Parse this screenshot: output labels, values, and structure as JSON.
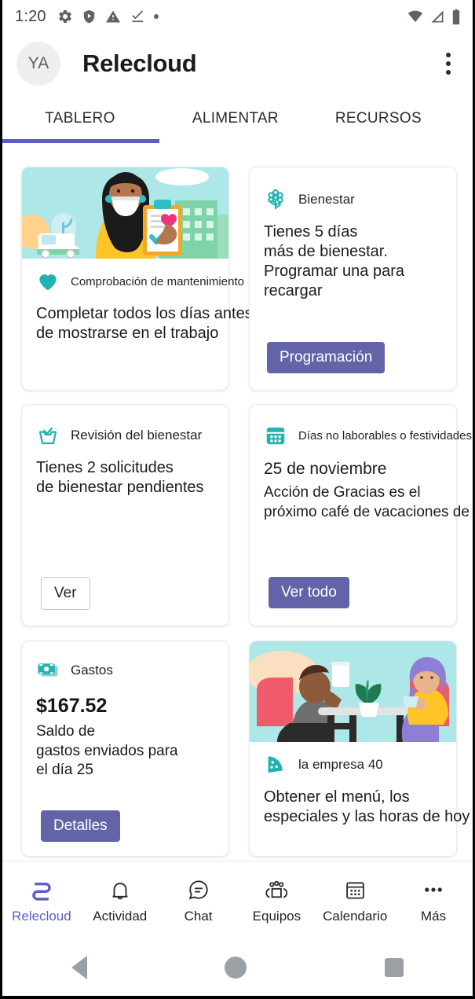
{
  "status_bar": {
    "time": "1:20",
    "left_icons": [
      "gear-icon",
      "shield-play-icon",
      "warning-icon",
      "check-underline-icon",
      "dot-icon"
    ],
    "right_icons": [
      "wifi-icon",
      "signal-icon",
      "battery-icon"
    ]
  },
  "app_bar": {
    "avatar_initials": "YA",
    "title": "Relecloud",
    "overflow": "more-options"
  },
  "tabs": {
    "items": [
      {
        "label": "TABLERO",
        "active": true
      },
      {
        "label": "ALIMENTAR",
        "active": false
      },
      {
        "label": "RECURSOS",
        "active": false
      }
    ],
    "active_color": "#5b5fc7"
  },
  "cards": {
    "maintenance_check": {
      "icon": "heart-icon",
      "title": "Comprobación de mantenimiento",
      "description": "Completar todos los días antes\nde mostrarse en el trabajo"
    },
    "wellbeing": {
      "icon": "flower-icon",
      "title": "Bienestar",
      "description": "Tienes 5 días\nmás de bienestar.\nProgramar una para\nrecargar",
      "button": "Programación"
    },
    "wellbeing_review": {
      "icon": "inbox-check-icon",
      "title": "Revisión del bienestar",
      "description": "Tienes 2 solicitudes\nde bienestar pendientes",
      "button": "Ver"
    },
    "holidays": {
      "icon": "calendar-icon",
      "title": "Días no laborables o festividades",
      "date": "25 de noviembre",
      "description": "Acción de Gracias es el\npróximo café de vacaciones de",
      "button": "Ver todo"
    },
    "expenses": {
      "icon": "money-icon",
      "title": "Gastos",
      "amount": "$167.52",
      "description": "Saldo de\ngastos enviados para\nel día 25",
      "button": "Detalles"
    },
    "company_cafe": {
      "icon": "pizza-icon",
      "title": "la empresa 40",
      "description": "Obtener el menú, los\nespeciales y las horas de hoy"
    }
  },
  "bottom_nav": {
    "items": [
      {
        "label": "Relecloud",
        "icon": "relecloud-logo-icon",
        "active": true
      },
      {
        "label": "Actividad",
        "icon": "bell-icon",
        "active": false
      },
      {
        "label": "Chat",
        "icon": "chat-bubble-icon",
        "active": false
      },
      {
        "label": "Equipos",
        "icon": "people-icon",
        "active": false
      },
      {
        "label": "Calendario",
        "icon": "calendar-icon",
        "active": false
      },
      {
        "label": "Más",
        "icon": "ellipsis-icon",
        "active": false
      }
    ]
  },
  "system_nav": {
    "back": "back-button",
    "home": "home-button",
    "recents": "recents-button"
  },
  "colors": {
    "accent_purple": "#6264a7",
    "tab_indicator": "#5b5fc7",
    "icon_teal": "#23b2b2",
    "illustration_bg": "#aee7e8"
  }
}
